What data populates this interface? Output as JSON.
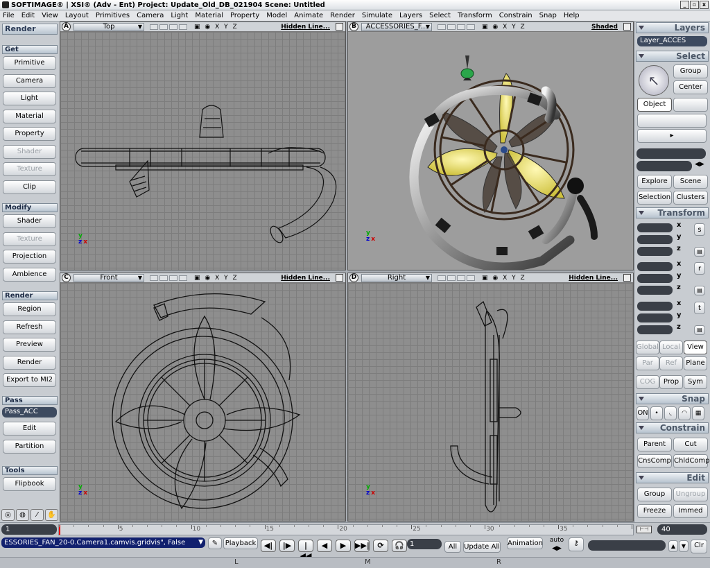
{
  "titlebar": {
    "title": "SOFTIMAGE® | XSI® (Adv - Ent) Project: Update_Old_DB_021904    Scene: Untitled",
    "buttons": [
      "_",
      "▫",
      "x"
    ]
  },
  "menu": [
    "File",
    "Edit",
    "View",
    "Layout",
    "Primitives",
    "Camera",
    "Light",
    "Material",
    "Property",
    "Model",
    "Animate",
    "Render",
    "Simulate",
    "Layers",
    "Select",
    "Transform",
    "Constrain",
    "Snap",
    "Help"
  ],
  "left": {
    "top_header": "Render",
    "sections": {
      "get": "Get",
      "modify": "Modify",
      "render": "Render",
      "pass": "Pass",
      "tools": "Tools"
    },
    "get": [
      "Primitive",
      "Camera",
      "Light",
      "Material",
      "Property",
      "Shader",
      "Texture",
      "Clip"
    ],
    "modify": [
      "Shader",
      "Texture",
      "Projection",
      "Ambience"
    ],
    "render": [
      "Region",
      "Refresh",
      "Preview",
      "Render",
      "Export to MI2"
    ],
    "pass_value": "Pass_ACC",
    "pass": [
      "Edit",
      "Partition"
    ],
    "tools": [
      "Flipbook"
    ]
  },
  "viewports": {
    "a": {
      "letter": "A",
      "camera": "Top",
      "mode": "Hidden Line...",
      "axes": "X Y Z"
    },
    "b": {
      "letter": "B",
      "camera": "ACCESSORIES_F...",
      "mode": "Shaded",
      "axes": "X Y Z"
    },
    "c": {
      "letter": "C",
      "camera": "Front",
      "mode": "Hidden Line...",
      "axes": "X Y Z"
    },
    "d": {
      "letter": "D",
      "camera": "Right",
      "mode": "Hidden Line...",
      "axes": "X Y Z"
    }
  },
  "gizmo": {
    "x": "x",
    "y": "y",
    "z": "z"
  },
  "right": {
    "layers": "Layers",
    "layer_value": "Layer_ACCES",
    "select": "Select",
    "group": "Group",
    "center": "Center",
    "object": "Object",
    "explore": "Explore",
    "scene": "Scene",
    "selection": "Selection",
    "clusters": "Clusters",
    "transform": "Transform",
    "x": "x",
    "y": "y",
    "z": "z",
    "s": "s",
    "r": "r",
    "t": "t",
    "global": "Global",
    "local": "Local",
    "view": "View",
    "par": "Par",
    "ref": "Ref",
    "plane": "Plane",
    "cog": "COG",
    "prop": "Prop",
    "sym": "Sym",
    "snap": "Snap",
    "snap_on": "ON",
    "constrain": "Constrain",
    "parent": "Parent",
    "cut": "Cut",
    "cnscomp": "CnsComp",
    "chldcomp": "ChldComp",
    "edit": "Edit",
    "egroup": "Group",
    "ungroup": "Ungroup",
    "freeze": "Freeze",
    "immed": "Immed"
  },
  "timeline": {
    "start": "1",
    "end": "40",
    "ticks": [
      "5",
      "10",
      "15",
      "20",
      "25",
      "30",
      "35"
    ]
  },
  "bottom": {
    "command": "ESSORIES_FAN_20-0.Camera1.camvis.gridvis\", False",
    "playback": "Playback",
    "frame": "1",
    "all": "All",
    "update_all": "Update All",
    "animation": "Animation",
    "auto": "auto",
    "clr": "Clr",
    "controls": [
      "◀|",
      "|▶",
      "|◀◀",
      "◀",
      "▶",
      "▶▶|",
      "⟳",
      "🎧"
    ]
  },
  "mouse": {
    "l": "L",
    "m": "M",
    "r": "R"
  }
}
